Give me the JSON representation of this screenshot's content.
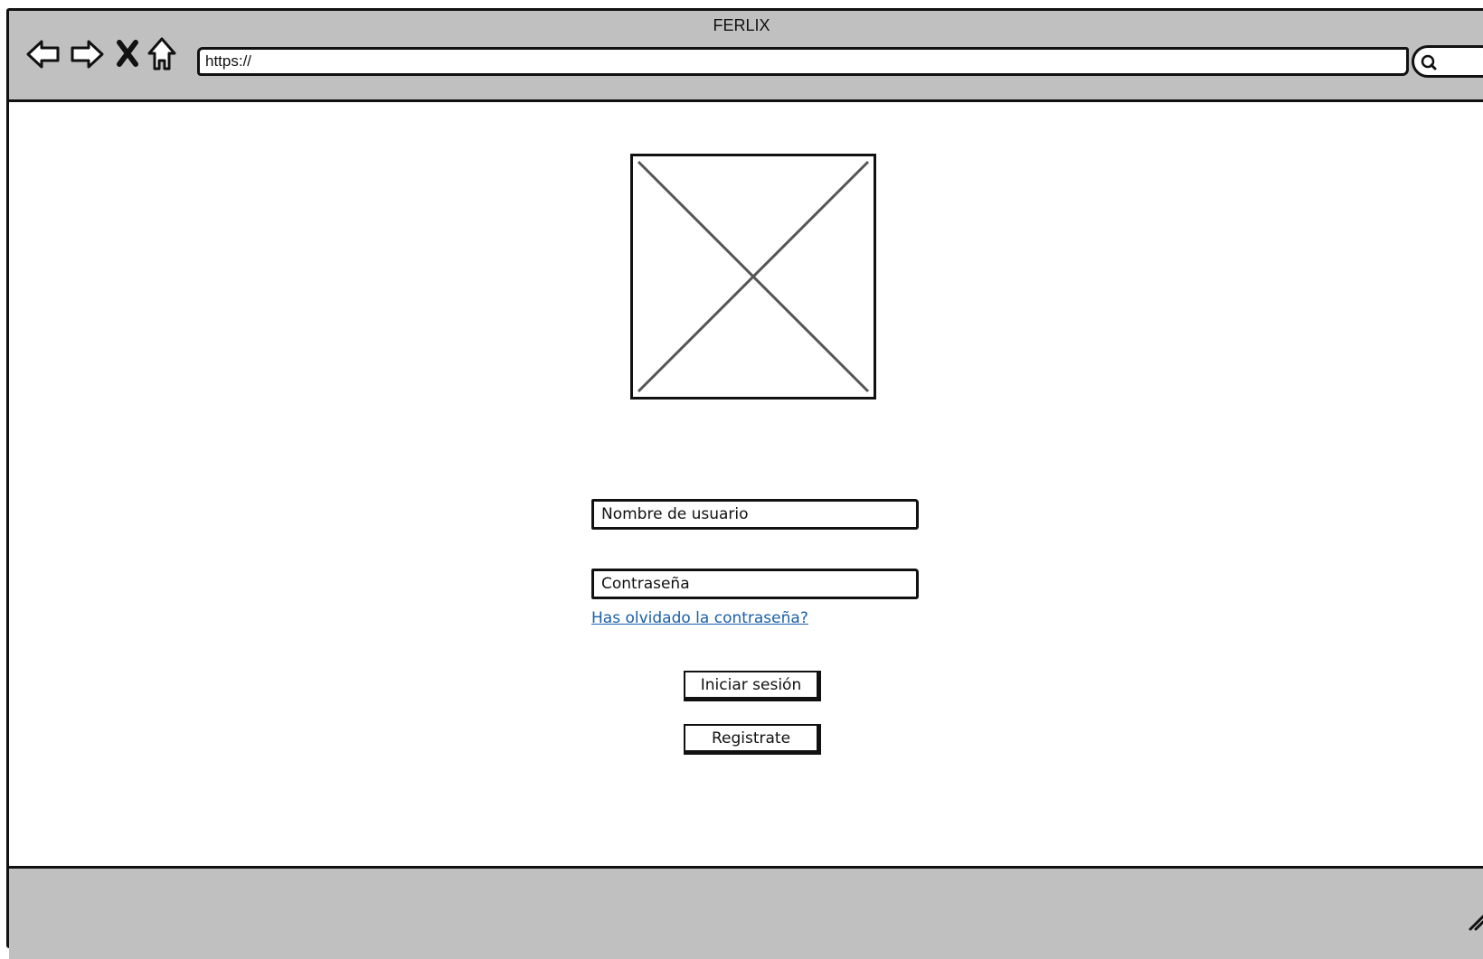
{
  "browser": {
    "title": "FERLIX",
    "url": "https://",
    "icons": [
      "back-arrow-icon",
      "forward-arrow-icon",
      "stop-icon",
      "home-icon",
      "search-icon"
    ]
  },
  "login": {
    "username_field": "Nombre de usuario",
    "password_field": "Contraseña",
    "forgot_link": "Has olvidado la contraseña?",
    "login_button": "Iniciar sesión",
    "register_button": "Registrate"
  },
  "colors": {
    "chrome": "#c0c0c0",
    "link": "#1a5fa8",
    "border": "#111111"
  }
}
